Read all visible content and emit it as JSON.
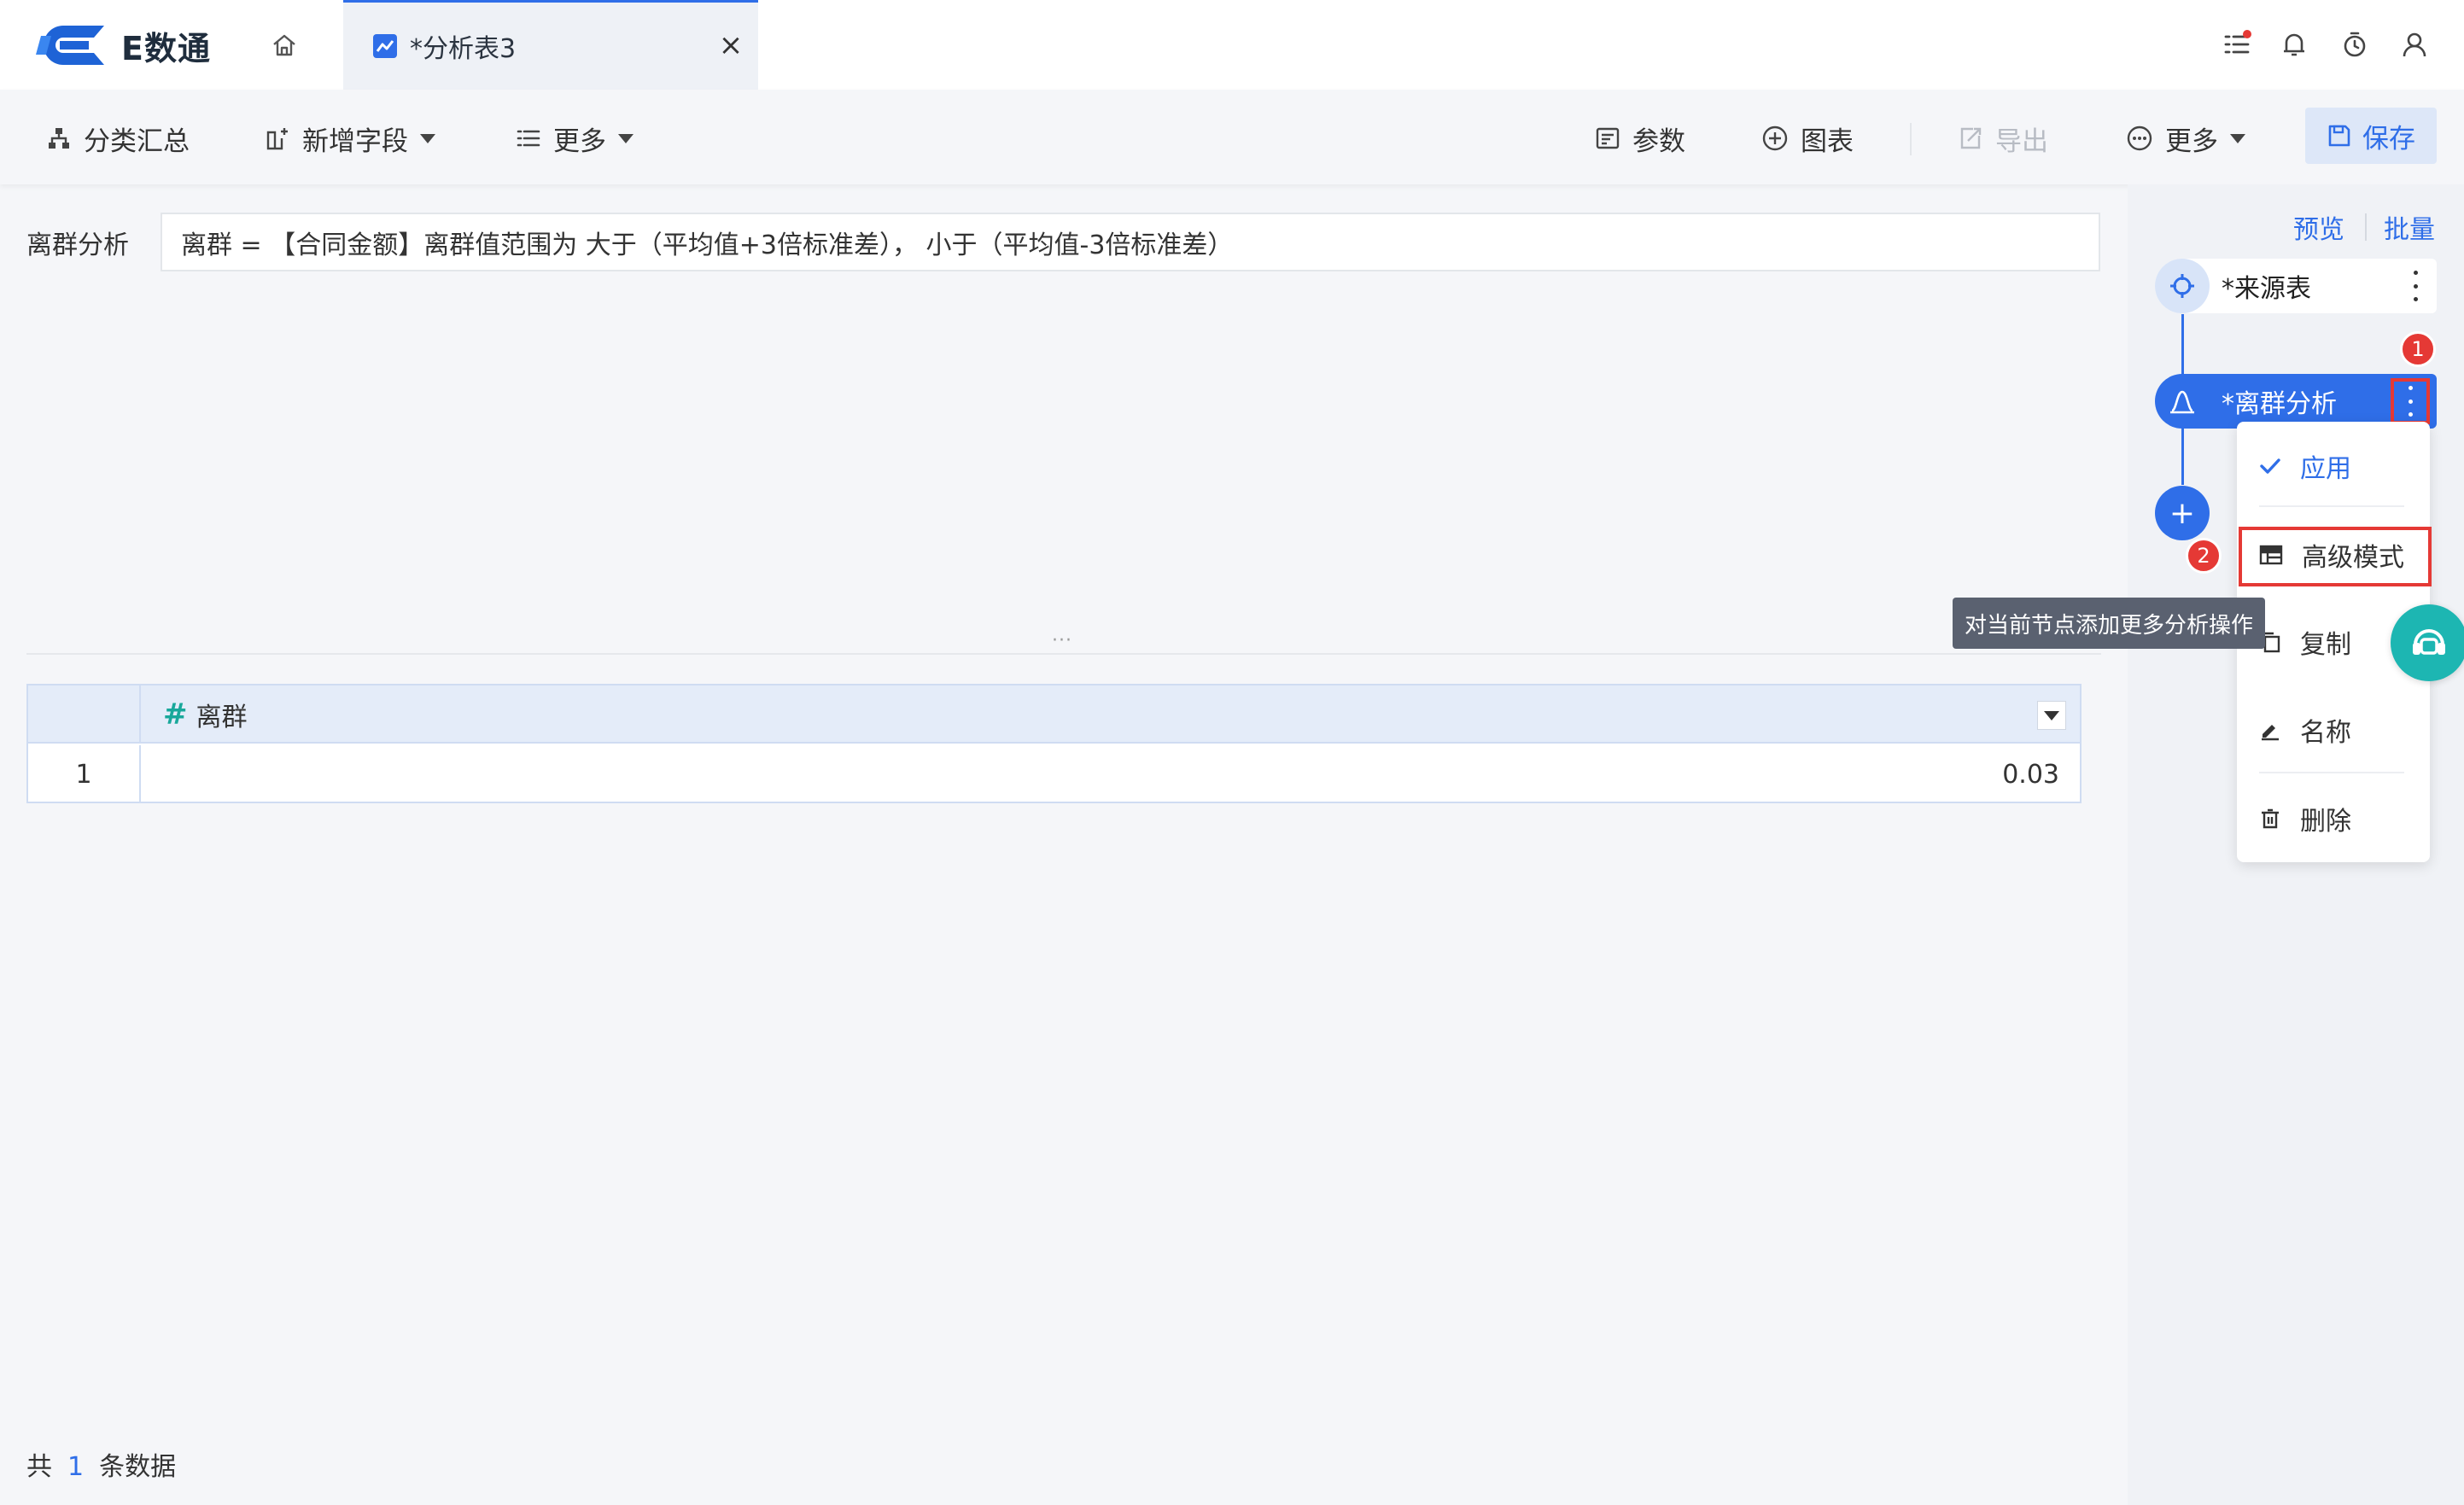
{
  "app": {
    "logo_text": "E数通",
    "active_tab": "*分析表3",
    "tab_close": "×"
  },
  "toolbar": {
    "group_summary": "分类汇总",
    "add_field": "新增字段",
    "more_left": "更多",
    "params": "参数",
    "chart": "图表",
    "export": "导出",
    "more_right": "更多",
    "save": "保存"
  },
  "formula": {
    "label": "离群分析",
    "expression": "离群 = 【合同金额】离群值范围为 大于（平均值+3倍标准差）， 小于（平均值-3倍标准差）"
  },
  "table": {
    "columns": [
      {
        "name": "离群",
        "type_symbol": "#"
      }
    ],
    "rows": [
      {
        "index": "1",
        "value": "0.03"
      }
    ],
    "split_handle": "···"
  },
  "footer": {
    "prefix": "共",
    "count": "1",
    "suffix": "条数据"
  },
  "panel": {
    "preview": "预览",
    "batch": "批量",
    "nodes": [
      {
        "label": "*来源表"
      },
      {
        "label": "*离群分析"
      }
    ],
    "add_symbol": "+",
    "badges": [
      "1",
      "2"
    ],
    "menu": [
      {
        "label": "应用"
      },
      {
        "label": "高级模式"
      },
      {
        "label": "复制"
      },
      {
        "label": "名称"
      },
      {
        "label": "删除"
      }
    ],
    "tooltip": "对当前节点添加更多分析操作"
  },
  "colors": {
    "primary": "#2f6ee8",
    "danger": "#e53935",
    "help": "#1db6b2"
  }
}
